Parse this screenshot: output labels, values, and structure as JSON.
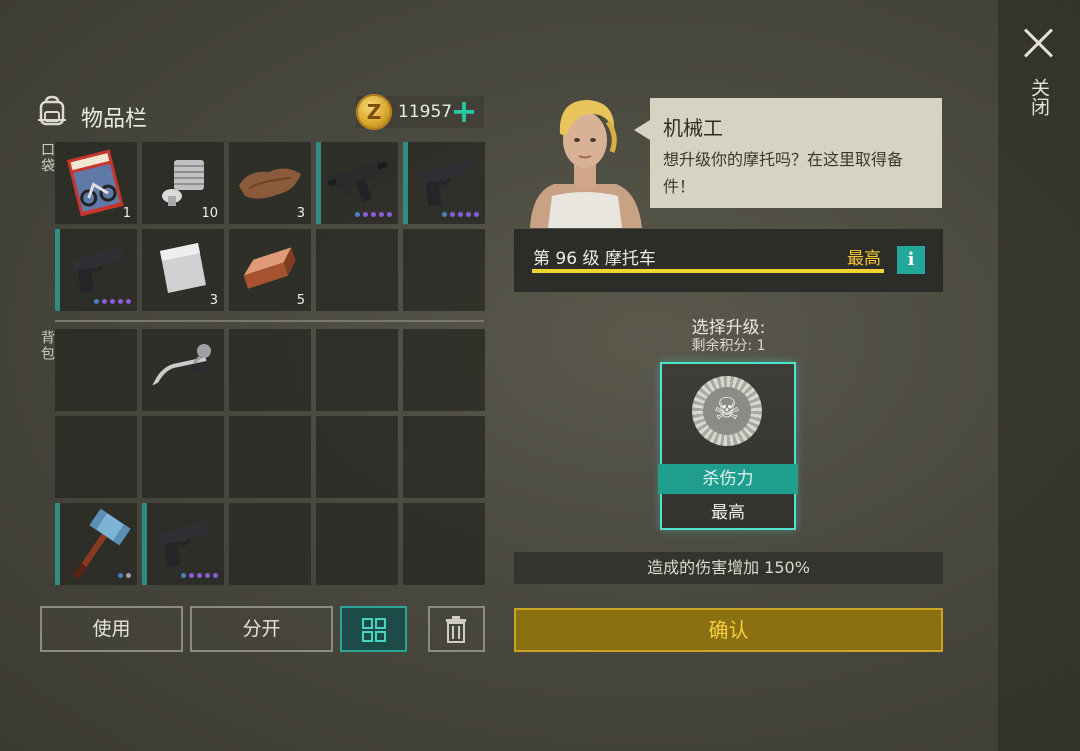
{
  "header": {
    "title": "物品栏",
    "coins": "11957",
    "coin_symbol": "Z",
    "close_label": "关闭"
  },
  "sections": {
    "pockets": "口袋",
    "backpack": "背包"
  },
  "pocket_slots": [
    {
      "item": "motorcycle-magazine",
      "qty": "1"
    },
    {
      "item": "engine-part",
      "qty": "10"
    },
    {
      "item": "leather",
      "qty": "3"
    },
    {
      "item": "uzi",
      "qty": "",
      "rarity_dots": 5
    },
    {
      "item": "pistol",
      "qty": "",
      "rarity_dots": 5
    },
    {
      "item": "pistol",
      "qty": "",
      "rarity_dots": 5
    },
    {
      "item": "metal-sheet",
      "qty": "3"
    },
    {
      "item": "copper-ingot",
      "qty": "5"
    },
    {
      "item": "",
      "qty": ""
    },
    {
      "item": "",
      "qty": ""
    }
  ],
  "backpack_slots": [
    {
      "item": ""
    },
    {
      "item": "handlebar"
    },
    {
      "item": ""
    },
    {
      "item": ""
    },
    {
      "item": ""
    },
    {
      "item": ""
    },
    {
      "item": ""
    },
    {
      "item": ""
    },
    {
      "item": ""
    },
    {
      "item": ""
    },
    {
      "item": "sledgehammer",
      "rarity_dots": 2
    },
    {
      "item": "pistol",
      "rarity_dots": 5
    },
    {
      "item": ""
    },
    {
      "item": ""
    },
    {
      "item": ""
    }
  ],
  "buttons": {
    "use": "使用",
    "split": "分开"
  },
  "npc": {
    "name": "机械工",
    "line": "想升级你的摩托吗？在这里取得备件！"
  },
  "level": {
    "text": "第 96 级  摩托车",
    "max": "最高",
    "progress": 1.0,
    "info": "i"
  },
  "upgrade": {
    "choose": "选择升级:",
    "remaining": "剩余积分:  1",
    "card_name": "杀伤力",
    "card_level": "最高",
    "effect": "造成的伤害增加 150%",
    "confirm": "确认"
  },
  "colors": {
    "accent": "#2aa597",
    "gold": "#f0c631",
    "purple": "#8b5cd6",
    "blue": "#4a7fc4"
  }
}
